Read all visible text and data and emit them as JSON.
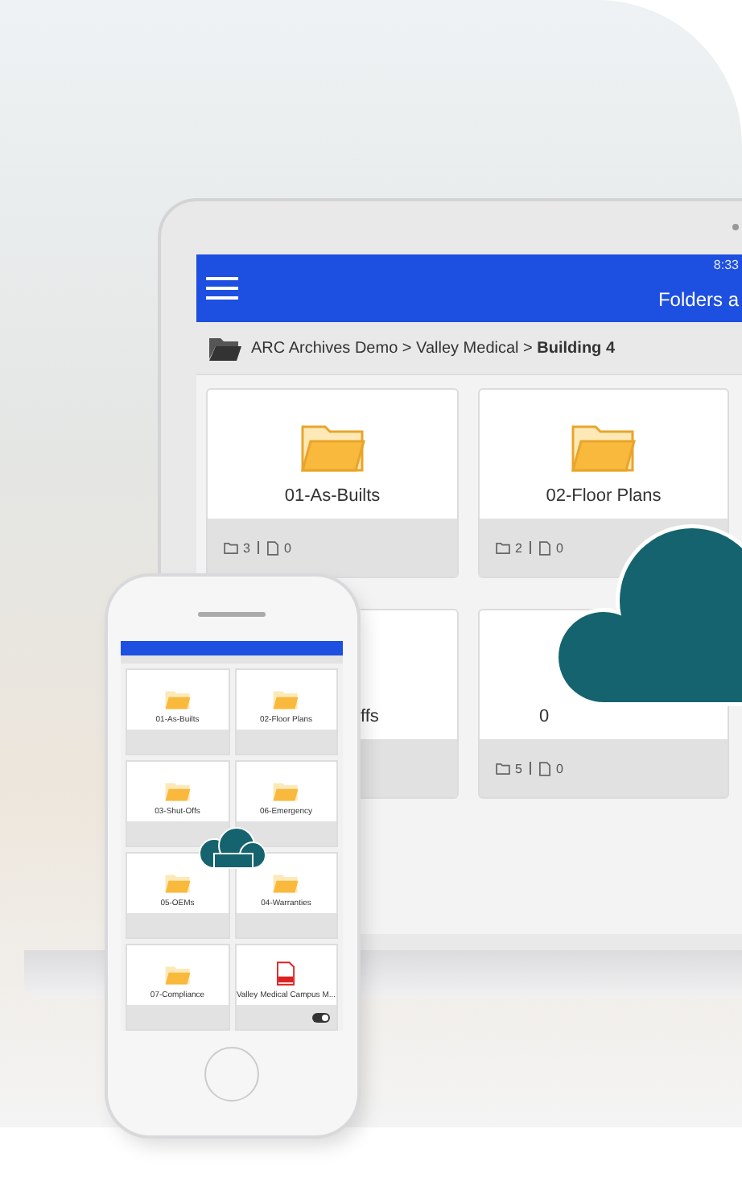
{
  "laptop": {
    "status_time": "8:33",
    "title": "Folders a",
    "breadcrumb": "ARC Archives Demo > Valley Medical > **Building 4**",
    "cards": [
      {
        "label": "01-As-Builts",
        "folders": "3",
        "files": "0",
        "kind": "full"
      },
      {
        "label": "02-Floor Plans",
        "folders": "2",
        "files": "0",
        "kind": "full"
      },
      {
        "label": "ffs",
        "kind": "tail"
      },
      {
        "label": "0",
        "folders": "5",
        "files": "0",
        "kind": "head"
      }
    ]
  },
  "phone": {
    "cards": [
      {
        "kind": "folder",
        "label": "01-As-Builts"
      },
      {
        "kind": "folder",
        "label": "02-Floor Plans"
      },
      {
        "kind": "folder",
        "label": "03-Shut-Offs"
      },
      {
        "kind": "folder",
        "label": "06-Emergency"
      },
      {
        "kind": "folder",
        "label": "05-OEMs"
      },
      {
        "kind": "folder",
        "label": "04-Warranties"
      },
      {
        "kind": "folder",
        "label": "07-Compliance"
      },
      {
        "kind": "document",
        "label": "Valley Medical Campus M...",
        "toggle_on": true
      }
    ]
  }
}
